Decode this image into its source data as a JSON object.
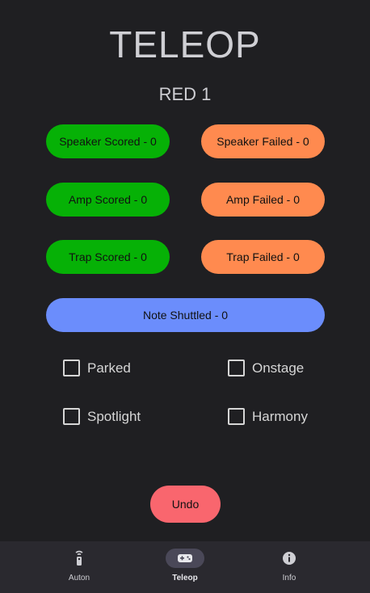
{
  "header": {
    "title": "TELEOP",
    "team": "RED 1"
  },
  "buttons": {
    "speaker_scored": "Speaker Scored - 0",
    "speaker_failed": "Speaker Failed - 0",
    "amp_scored": "Amp Scored - 0",
    "amp_failed": "Amp Failed - 0",
    "trap_scored": "Trap Scored - 0",
    "trap_failed": "Trap Failed - 0",
    "note_shuttled": "Note Shuttled - 0",
    "undo": "Undo"
  },
  "checkboxes": {
    "parked": {
      "label": "Parked",
      "checked": false
    },
    "onstage": {
      "label": "Onstage",
      "checked": false
    },
    "spotlight": {
      "label": "Spotlight",
      "checked": false
    },
    "harmony": {
      "label": "Harmony",
      "checked": false
    }
  },
  "nav": {
    "items": [
      {
        "label": "Auton",
        "icon": "remote-icon",
        "active": false
      },
      {
        "label": "Teleop",
        "icon": "gamepad-icon",
        "active": true
      },
      {
        "label": "Info",
        "icon": "info-icon",
        "active": false
      }
    ]
  },
  "colors": {
    "scored": "#06b106",
    "failed": "#ff8a4f",
    "shuttled": "#6b8dfc",
    "undo": "#f9666e",
    "background": "#1f1f22"
  }
}
